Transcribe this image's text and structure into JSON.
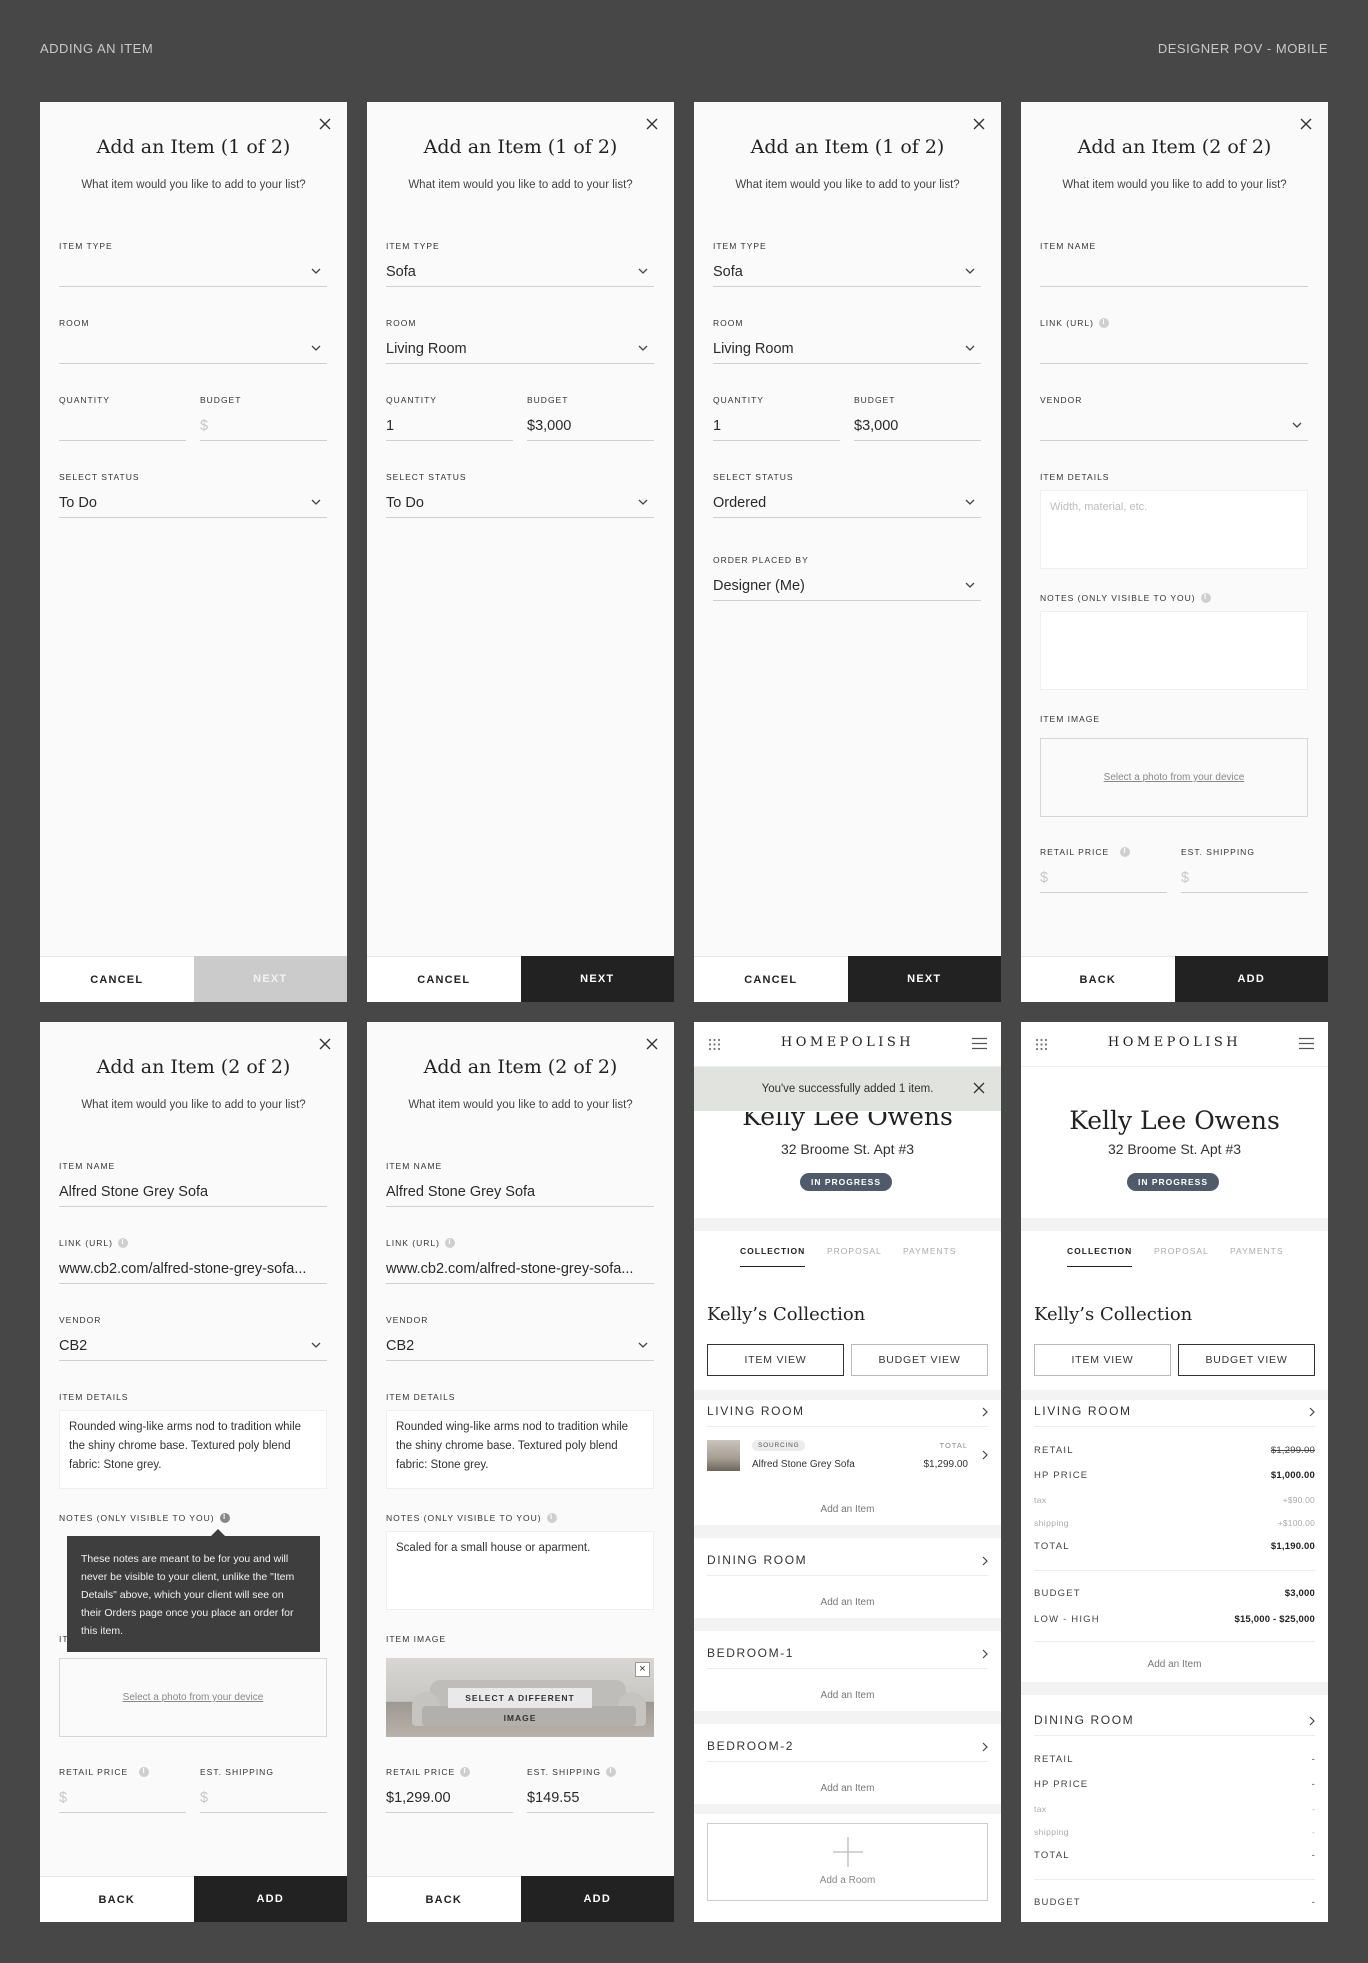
{
  "header": {
    "left": "ADDING AN ITEM",
    "right": "DESIGNER POV - MOBILE"
  },
  "labels": {
    "item_type": "ITEM TYPE",
    "room": "ROOM",
    "quantity": "QUANTITY",
    "budget": "BUDGET",
    "select_status": "SELECT STATUS",
    "order_placed_by": "ORDER PLACED BY",
    "item_name": "ITEM NAME",
    "link_url": "LINK (URL)",
    "vendor": "VENDOR",
    "item_details": "ITEM DETAILS",
    "notes": "NOTES (ONLY VISIBLE TO YOU)",
    "item_image": "ITEM IMAGE",
    "retail_price": "RETAIL PRICE",
    "est_shipping": "EST. SHIPPING",
    "subtitle": "What item would you like to add to your list?",
    "title_1": "Add an Item (1 of 2)",
    "title_2": "Add an Item (2 of 2)",
    "cancel": "CANCEL",
    "next": "NEXT",
    "back": "BACK",
    "add": "ADD",
    "dollar": "$",
    "details_placeholder": "Width, material, etc.",
    "select_photo": "Select a photo from your device",
    "select_different_image": "SELECT A DIFFERENT IMAGE",
    "info": "i"
  },
  "step1": {
    "item_type": "Sofa",
    "room": "Living Room",
    "quantity": "1",
    "budget": "$3,000",
    "status_todo": "To Do",
    "status_ordered": "Ordered",
    "order_placed_by": "Designer (Me)"
  },
  "step2": {
    "item_name": "Alfred Stone Grey Sofa",
    "link": "www.cb2.com/alfred-stone-grey-sofa...",
    "vendor": "CB2",
    "details": "Rounded wing-like arms nod to tradition while the shiny chrome base. Textured poly blend fabric: Stone grey.",
    "notes": "Scaled for a small house or aparment.",
    "notes_tooltip": "These notes are meant to be for you and will never be visible to your client, unlike the \"Item Details\" above, which your client will see on their Orders page once you place an order for this item.",
    "tooltip_hidden_label_fragment": "IT",
    "retail_price": "$1,299.00",
    "est_shipping": "$149.55"
  },
  "homepolish": {
    "logo": "HOMEPOLISH",
    "toast": "You've successfully added 1 item.",
    "client": "Kelly Lee Owens",
    "address": "32 Broome St. Apt #3",
    "badge": "IN PROGRESS",
    "tabs": [
      "COLLECTION",
      "PROPOSAL",
      "PAYMENTS"
    ],
    "collection_title": "Kelly’s Collection",
    "item_view": "ITEM VIEW",
    "budget_view": "BUDGET VIEW",
    "rooms": [
      "LIVING ROOM",
      "DINING ROOM",
      "BEDROOM-1",
      "BEDROOM-2"
    ],
    "add_item": "Add an Item",
    "add_room": "Add a Room",
    "item": {
      "tag": "SOURCING",
      "name": "Alfred Stone Grey Sofa",
      "total_label": "TOTAL",
      "total": "$1,299.00"
    },
    "budget_rows": {
      "retail_label": "RETAIL",
      "retail": "$1,299.00",
      "hp_label": "HP PRICE",
      "hp": "$1,000.00",
      "tax_label": "tax",
      "tax": "+$90.00",
      "shipping_label": "shipping",
      "shipping": "+$100.00",
      "total_label": "TOTAL",
      "total": "$1,190.00",
      "budget_label": "BUDGET",
      "budget": "$3,000",
      "lowhigh_label": "LOW - HIGH",
      "lowhigh": "$15,000 - $25,000",
      "dash": "-"
    }
  }
}
